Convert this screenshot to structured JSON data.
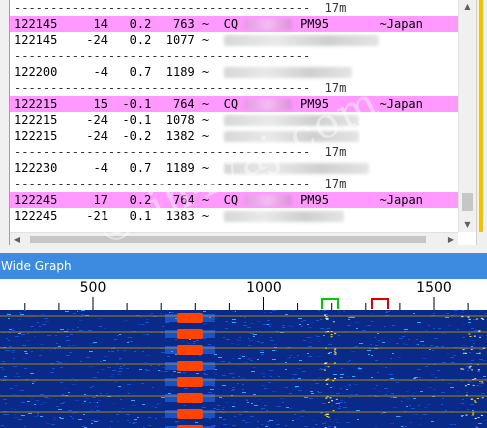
{
  "decode_window": {
    "rows": [
      {
        "type": "sep",
        "text": "-----------------------------------------  17m"
      },
      {
        "type": "cq",
        "utc": "122145",
        "db": "14",
        "dt": "0.2",
        "freq": "763",
        "mark": "~",
        "msg_prefix": "CQ",
        "grid": "PM95",
        "country": "~Japan",
        "blur": [
          [
            230,
            50
          ]
        ]
      },
      {
        "type": "std",
        "utc": "122145",
        "db": "-24",
        "dt": "0.2",
        "freq": "1077",
        "mark": "~",
        "blur": [
          [
            205,
            155
          ]
        ]
      },
      {
        "type": "sep",
        "text": "-----------------------------------------"
      },
      {
        "type": "std",
        "utc": "122200",
        "db": "-4",
        "dt": "0.7",
        "freq": "1189",
        "mark": "~",
        "blur": [
          [
            198,
            128
          ]
        ]
      },
      {
        "type": "sep",
        "text": "-----------------------------------------  17m"
      },
      {
        "type": "cq",
        "utc": "122215",
        "db": "15",
        "dt": "-0.1",
        "freq": "764",
        "mark": "~",
        "msg_prefix": "CQ",
        "grid": "PM95",
        "country": "~Japan",
        "blur": [
          [
            230,
            50
          ]
        ]
      },
      {
        "type": "std",
        "utc": "122215",
        "db": "-24",
        "dt": "-0.1",
        "freq": "1078",
        "mark": "~",
        "blur": [
          [
            205,
            135
          ]
        ]
      },
      {
        "type": "std",
        "utc": "122215",
        "db": "-24",
        "dt": "-0.2",
        "freq": "1382",
        "mark": "~",
        "blur": [
          [
            205,
            135
          ]
        ]
      },
      {
        "type": "sep",
        "text": "-----------------------------------------  17m"
      },
      {
        "type": "std",
        "utc": "122230",
        "db": "-4",
        "dt": "0.7",
        "freq": "1189",
        "mark": "~",
        "blur": [
          [
            205,
            145
          ]
        ]
      },
      {
        "type": "sep",
        "text": "-----------------------------------------  17m"
      },
      {
        "type": "cq",
        "utc": "122245",
        "db": "17",
        "dt": "0.2",
        "freq": "764",
        "mark": "~",
        "msg_prefix": "CQ",
        "grid": "PM95",
        "country": "~Japan",
        "blur": [
          [
            230,
            50
          ]
        ]
      },
      {
        "type": "std",
        "utc": "122245",
        "db": "-21",
        "dt": "0.1",
        "freq": "1383",
        "mark": "~",
        "blur": [
          [
            205,
            120
          ]
        ]
      }
    ]
  },
  "wide_graph": {
    "title": "Wide Graph",
    "scale_labels": [
      "500",
      "1000",
      "1500"
    ],
    "colors": {
      "waterfall_bg": "#0a2a8a",
      "signal": "#ff4400",
      "rx_marker": "#00cc00",
      "tx_marker": "#dd0000"
    }
  },
  "watermark": "© jh4vaj.com"
}
